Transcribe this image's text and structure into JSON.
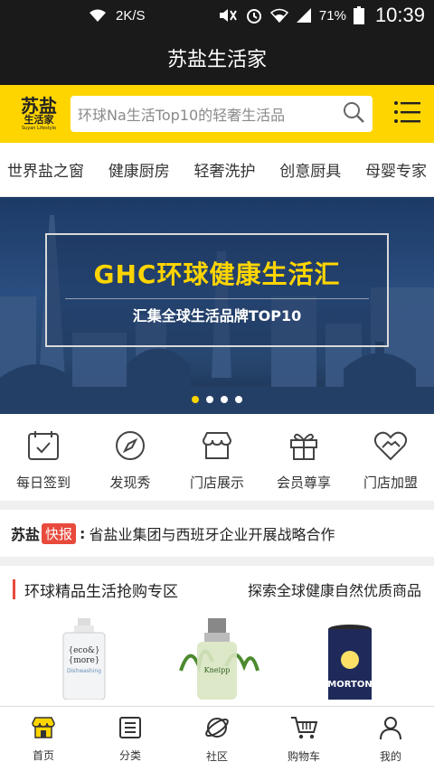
{
  "status_bar": {
    "network_speed": "2K/S",
    "battery": "71%",
    "time": "10:39",
    "icons": [
      "wifi-icon",
      "mute-icon",
      "alarm-icon",
      "wifi-signal-icon",
      "cell-signal-icon",
      "battery-icon"
    ]
  },
  "app": {
    "title": "苏盐生活家"
  },
  "logo": {
    "line1": "苏盐",
    "line2": "生活家",
    "line3": "Suyan Lifestyle"
  },
  "search": {
    "placeholder": "环球Na生活Top10的轻奢生活品"
  },
  "categories": [
    "世界盐之窗",
    "健康厨房",
    "轻奢洗护",
    "创意厨具",
    "母婴专家"
  ],
  "banner": {
    "headline": "GHC环球健康生活汇",
    "subtitle": "汇集全球生活品牌TOP10",
    "slides": 4,
    "active_slide": 1
  },
  "quick_links": [
    {
      "label": "每日签到",
      "icon": "calendar-check-icon"
    },
    {
      "label": "发现秀",
      "icon": "compass-icon"
    },
    {
      "label": "门店展示",
      "icon": "storefront-icon"
    },
    {
      "label": "会员尊享",
      "icon": "gift-icon"
    },
    {
      "label": "门店加盟",
      "icon": "handshake-heart-icon"
    }
  ],
  "news": {
    "brand": "苏盐",
    "badge": "快报",
    "text": "省盐业集团与西班牙企业开展战略合作"
  },
  "section": {
    "title": "环球精品生活抢购专区",
    "more": "探索全球健康自然优质商品"
  },
  "products": [
    {
      "name": "eco&more dishwashing bottle",
      "label_top": "{eco&}",
      "label_mid": "{more}",
      "label_sub": "Dishwashing"
    },
    {
      "name": "Kneipp oil bottle",
      "label_top": "Kneipp"
    },
    {
      "name": "Morton salt canister",
      "label_top": "MORTON"
    }
  ],
  "bottom_nav": [
    {
      "label": "首页",
      "icon": "home-store-icon",
      "active": true
    },
    {
      "label": "分类",
      "icon": "list-icon"
    },
    {
      "label": "社区",
      "icon": "planet-icon"
    },
    {
      "label": "购物车",
      "icon": "cart-icon"
    },
    {
      "label": "我的",
      "icon": "user-icon"
    }
  ],
  "colors": {
    "brand_yellow": "#ffd500",
    "dark_bar": "#1a1a1a",
    "accent_red": "#e84a3c"
  }
}
